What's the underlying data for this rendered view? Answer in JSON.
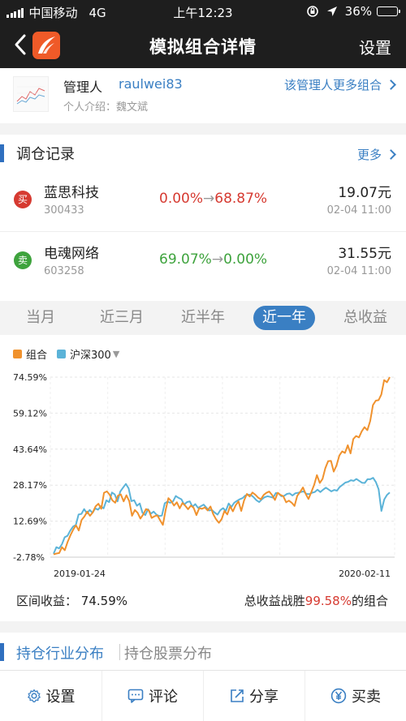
{
  "status_bar": {
    "carrier": "中国移动",
    "network": "4G",
    "time": "上午12:23",
    "battery": "36%"
  },
  "nav": {
    "title": "模拟组合详情",
    "settings_label": "设置"
  },
  "manager": {
    "label": "管理人",
    "name": "raulwei83",
    "intro": "个人介绍：魏文斌",
    "more_link": "该管理人更多组合"
  },
  "rebalance": {
    "title": "调仓记录",
    "more_label": "更多",
    "trades": [
      {
        "action": "买",
        "name": "蓝思科技",
        "code": "300433",
        "from_pct": "0.00%",
        "to_pct": "68.87%",
        "price": "19.07元",
        "time": "02-04 11:00"
      },
      {
        "action": "卖",
        "name": "电魂网络",
        "code": "603258",
        "from_pct": "69.07%",
        "to_pct": "0.00%",
        "price": "31.55元",
        "time": "02-04 11:00"
      }
    ]
  },
  "period_tabs": [
    "当月",
    "近三月",
    "近半年",
    "近一年",
    "总收益"
  ],
  "active_period": "近一年",
  "chart_summary": {
    "interval_label": "区间收益：",
    "interval_value": "74.59%",
    "winrate_prefix": "总收益战胜",
    "winrate_value": "99.58%",
    "winrate_suffix": "的组合"
  },
  "distribution_tabs": {
    "industry": "持仓行业分布",
    "stocks": "持仓股票分布"
  },
  "bottom_bar": {
    "settings": "设置",
    "comment": "评论",
    "share": "分享",
    "trade": "买卖"
  },
  "colors": {
    "portfolio": "#f0922e",
    "index": "#5bb3d8",
    "accent": "#3a7fc3",
    "up": "#d63a31",
    "down": "#3ea33d"
  },
  "chart_data": {
    "type": "line",
    "x_start_label": "2019-01-24",
    "x_end_label": "2020-02-11",
    "y_tick_labels": [
      "74.59%",
      "59.12%",
      "43.64%",
      "28.17%",
      "12.69%",
      "-2.78%"
    ],
    "ylim": [
      -2.78,
      74.59
    ],
    "legend_extra": "▼",
    "grid": true,
    "series": [
      {
        "name": "组合",
        "values": [
          -1.6,
          -1.2,
          -1.0,
          1.5,
          0.2,
          3.8,
          6.6,
          9.1,
          10.9,
          8.7,
          13.2,
          14.7,
          16.8,
          15.0,
          16.5,
          19.1,
          20.2,
          18.0,
          24.9,
          25.5,
          24.1,
          21.6,
          20.6,
          23.7,
          24.2,
          21.2,
          23.8,
          21.3,
          15.0,
          17.5,
          16.3,
          13.8,
          15.6,
          17.9,
          17.3,
          14.1,
          14.8,
          15.2,
          13.1,
          11.1,
          17.5,
          22.6,
          21.3,
          19.4,
          20.8,
          18.2,
          20.5,
          19.3,
          17.8,
          19.4,
          18.4,
          15.3,
          18.3,
          18.0,
          18.6,
          17.3,
          19.0,
          15.7,
          13.5,
          12.0,
          13.6,
          17.1,
          15.6,
          19.1,
          16.9,
          19.6,
          21.2,
          17.1,
          21.6,
          24.4,
          23.3,
          25.0,
          24.1,
          22.8,
          22.1,
          24.0,
          24.9,
          25.4,
          23.9,
          21.8,
          24.9,
          24.0,
          23.4,
          20.8,
          21.5,
          20.6,
          19.2,
          23.6,
          25.2,
          27.2,
          24.4,
          22.2,
          25.2,
          28.3,
          32.5,
          29.1,
          30.8,
          35.4,
          38.5,
          38.6,
          34.0,
          36.6,
          40.9,
          42.7,
          42.0,
          45.3,
          41.8,
          48.0,
          49.3,
          48.7,
          51.3,
          53.1,
          51.8,
          55.7,
          62.6,
          64.5,
          64.7,
          67.1,
          73.3,
          72.4,
          74.6
        ]
      },
      {
        "name": "沪深300",
        "values": [
          -1.3,
          1.5,
          1.0,
          2.8,
          5.8,
          6.4,
          8.6,
          10.4,
          11.1,
          15.6,
          15.8,
          17.9,
          16.0,
          17.5,
          16.3,
          18.2,
          17.6,
          19.1,
          18.2,
          21.6,
          20.9,
          25.0,
          24.2,
          21.2,
          25.4,
          27.1,
          28.7,
          26.8,
          21.3,
          21.7,
          19.3,
          20.3,
          16.3,
          15.3,
          17.8,
          15.9,
          16.8,
          15.5,
          14.9,
          15.1,
          20.4,
          21.1,
          20.6,
          21.2,
          23.5,
          22.7,
          22.1,
          19.8,
          20.9,
          21.2,
          18.9,
          20.0,
          18.4,
          19.1,
          19.8,
          18.5,
          17.3,
          17.5,
          16.4,
          15.5,
          17.4,
          18.3,
          17.1,
          20.3,
          18.8,
          20.6,
          21.4,
          22.1,
          22.6,
          23.7,
          24.1,
          24.0,
          23.0,
          21.7,
          20.9,
          22.1,
          23.0,
          23.4,
          23.1,
          22.8,
          24.8,
          24.6,
          23.4,
          23.6,
          24.4,
          24.6,
          23.7,
          24.7,
          24.9,
          25.2,
          25.5,
          24.4,
          24.3,
          24.9,
          25.2,
          26.2,
          25.2,
          26.2,
          27.1,
          26.3,
          25.5,
          26.1,
          25.8,
          27.4,
          28.3,
          29.3,
          29.6,
          30.3,
          30.0,
          30.8,
          30.0,
          29.2,
          29.1,
          30.7,
          30.7,
          31.3,
          29.5,
          26.4,
          17.1,
          22.0,
          24.0,
          25.0
        ]
      }
    ]
  }
}
